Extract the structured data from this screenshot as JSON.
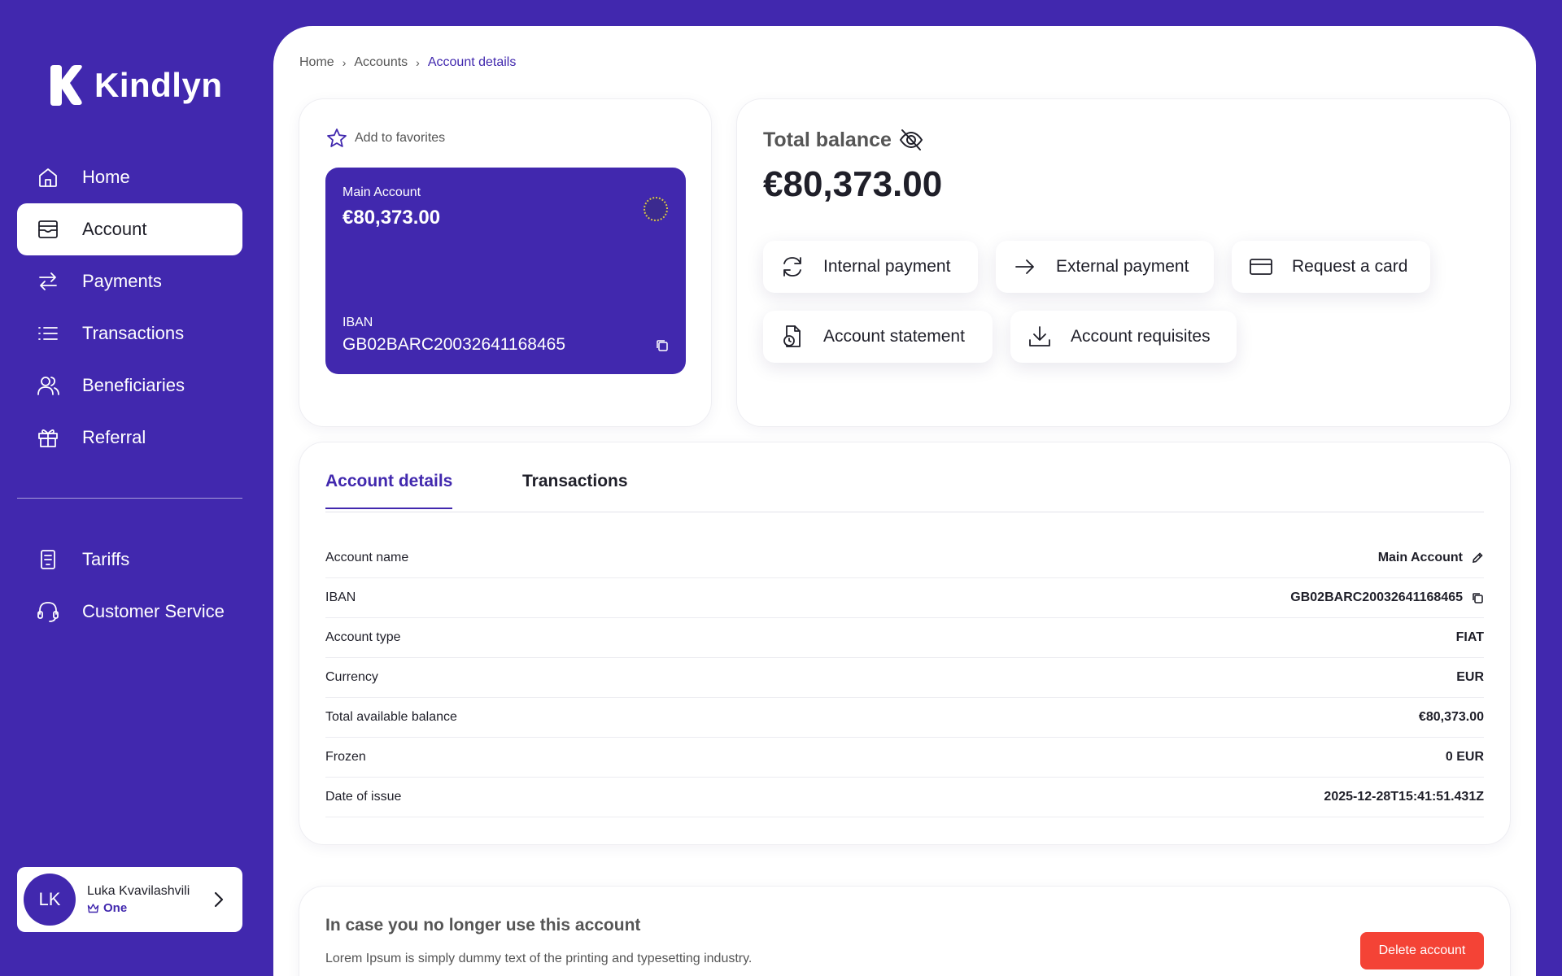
{
  "app": {
    "name": "Kindlyn"
  },
  "sidebar": {
    "items": [
      {
        "label": "Home",
        "icon": "home-icon"
      },
      {
        "label": "Account",
        "icon": "wallet-icon"
      },
      {
        "label": "Payments",
        "icon": "arrows-icon"
      },
      {
        "label": "Transactions",
        "icon": "list-icon"
      },
      {
        "label": "Beneficiaries",
        "icon": "users-icon"
      },
      {
        "label": "Referral",
        "icon": "gift-icon"
      }
    ],
    "secondary_items": [
      {
        "label": "Tariffs",
        "icon": "document-icon"
      },
      {
        "label": "Customer Service",
        "icon": "headset-icon"
      }
    ],
    "active": "Account"
  },
  "user": {
    "initials": "LK",
    "name": "Luka Kvavilashvili",
    "plan": "One"
  },
  "breadcrumb": {
    "home": "Home",
    "accounts": "Accounts",
    "current": "Account details"
  },
  "account_card": {
    "favorites_label": "Add to favorites",
    "name": "Main Account",
    "balance": "€80,373.00",
    "iban_label": "IBAN",
    "iban": "GB02BARC20032641168465"
  },
  "balance_panel": {
    "label": "Total balance",
    "value": "€80,373.00",
    "actions": {
      "internal": "Internal payment",
      "external": "External payment",
      "card": "Request a card",
      "statement": "Account statement",
      "requisites": "Account requisites"
    }
  },
  "details": {
    "tabs": {
      "details": "Account details",
      "transactions": "Transactions"
    },
    "rows": [
      {
        "label": "Account name",
        "value": "Main Account"
      },
      {
        "label": "IBAN",
        "value": "GB02BARC20032641168465"
      },
      {
        "label": "Account type",
        "value": "FIAT"
      },
      {
        "label": "Currency",
        "value": "EUR"
      },
      {
        "label": "Total available balance",
        "value": "€80,373.00"
      },
      {
        "label": "Frozen",
        "value": "0 EUR"
      },
      {
        "label": "Date of issue",
        "value": "2025-12-28T15:41:51.431Z"
      }
    ]
  },
  "delete_section": {
    "title": "In case you no longer use this account",
    "text": "Lorem Ipsum is simply dummy text of the printing and typesetting industry.",
    "button": "Delete account"
  },
  "colors": {
    "brand": "#4128ae",
    "danger": "#f44336",
    "text": "#1f1f29"
  }
}
